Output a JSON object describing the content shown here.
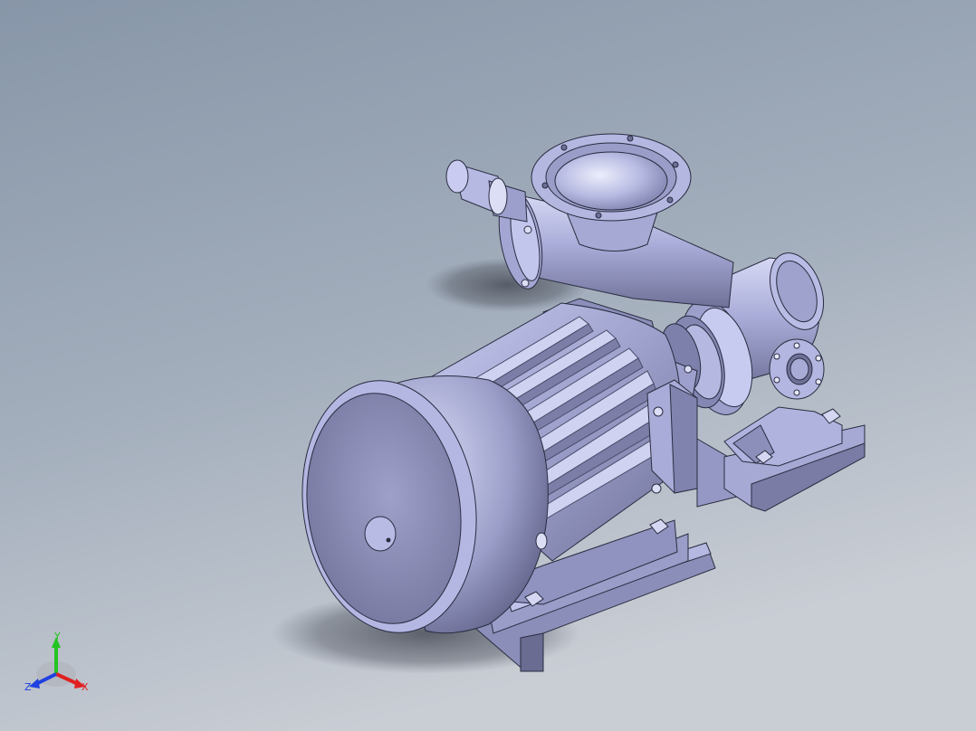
{
  "viewport": {
    "background_top": "#8796a8",
    "background_bottom": "#c7ccd3",
    "model_color": "#a8abd6"
  },
  "triad": {
    "y_label": "Y",
    "x_label": "X",
    "z_label": "Z",
    "y_color": "#22c422",
    "x_color": "#e02020",
    "z_color": "#2040e0"
  }
}
